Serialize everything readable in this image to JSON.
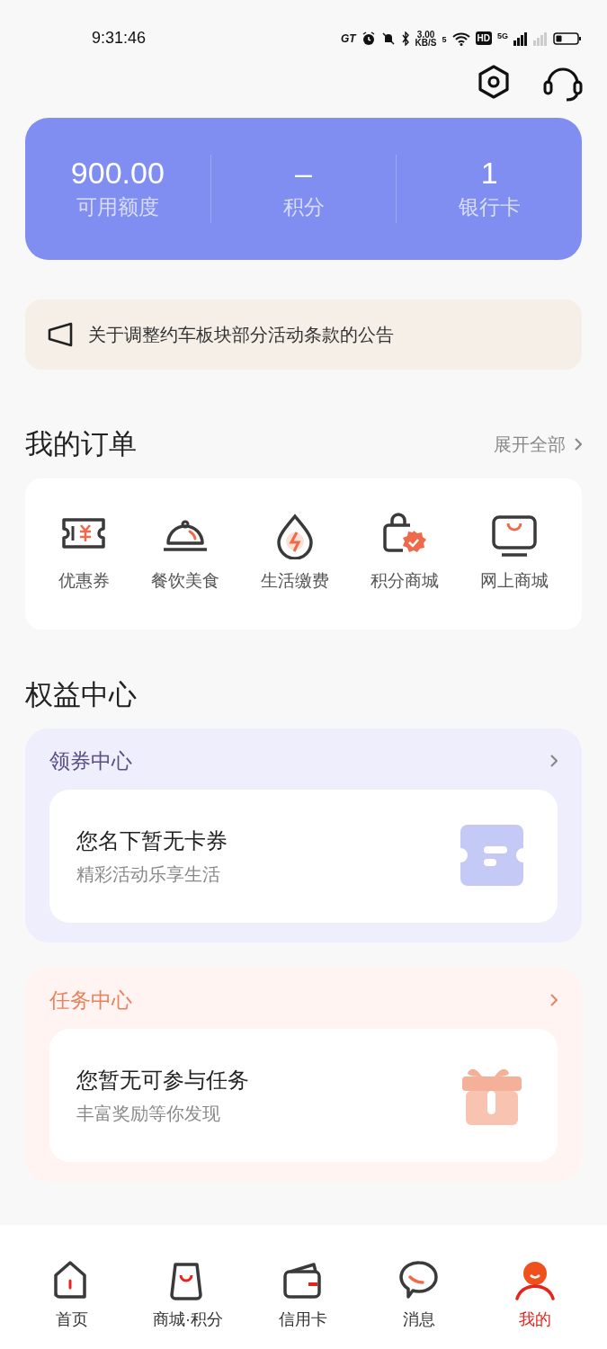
{
  "status_bar": {
    "time": "9:31:46",
    "carrier_badge": "GT",
    "speed_value": "3.00",
    "speed_unit": "KB/S",
    "wifi_label": "5",
    "hd_badge": "HD",
    "network_type": "5G"
  },
  "header": {
    "buttons": [
      {
        "kind": "settings"
      },
      {
        "kind": "support"
      }
    ]
  },
  "summary": [
    {
      "value": "900.00",
      "label": "可用额度"
    },
    {
      "value": "–",
      "label": "积分"
    },
    {
      "value": "1",
      "label": "银行卡"
    }
  ],
  "notice": {
    "text": "关于调整约车板块部分活动条款的公告"
  },
  "orders": {
    "title": "我的订单",
    "more": "展开全部",
    "items": [
      {
        "kind": "coupon",
        "label": "优惠券"
      },
      {
        "kind": "dining",
        "label": "餐饮美食"
      },
      {
        "kind": "utility",
        "label": "生活缴费"
      },
      {
        "kind": "points",
        "label": "积分商城"
      },
      {
        "kind": "shop",
        "label": "网上商城"
      }
    ]
  },
  "benefits": {
    "title": "权益中心",
    "cards": [
      {
        "kind": "coupon",
        "title": "领券中心",
        "message": "您名下暂无卡券",
        "hint": "精彩活动乐享生活"
      },
      {
        "kind": "task",
        "title": "任务中心",
        "message": "您暂无可参与任务",
        "hint": "丰富奖励等你发现"
      }
    ]
  },
  "tab_bar": [
    {
      "kind": "home",
      "label": "首页",
      "selected": false
    },
    {
      "kind": "mall",
      "label": "商城·积分",
      "selected": false
    },
    {
      "kind": "card",
      "label": "信用卡",
      "selected": false
    },
    {
      "kind": "message",
      "label": "消息",
      "selected": false
    },
    {
      "kind": "me",
      "label": "我的",
      "selected": true
    }
  ]
}
